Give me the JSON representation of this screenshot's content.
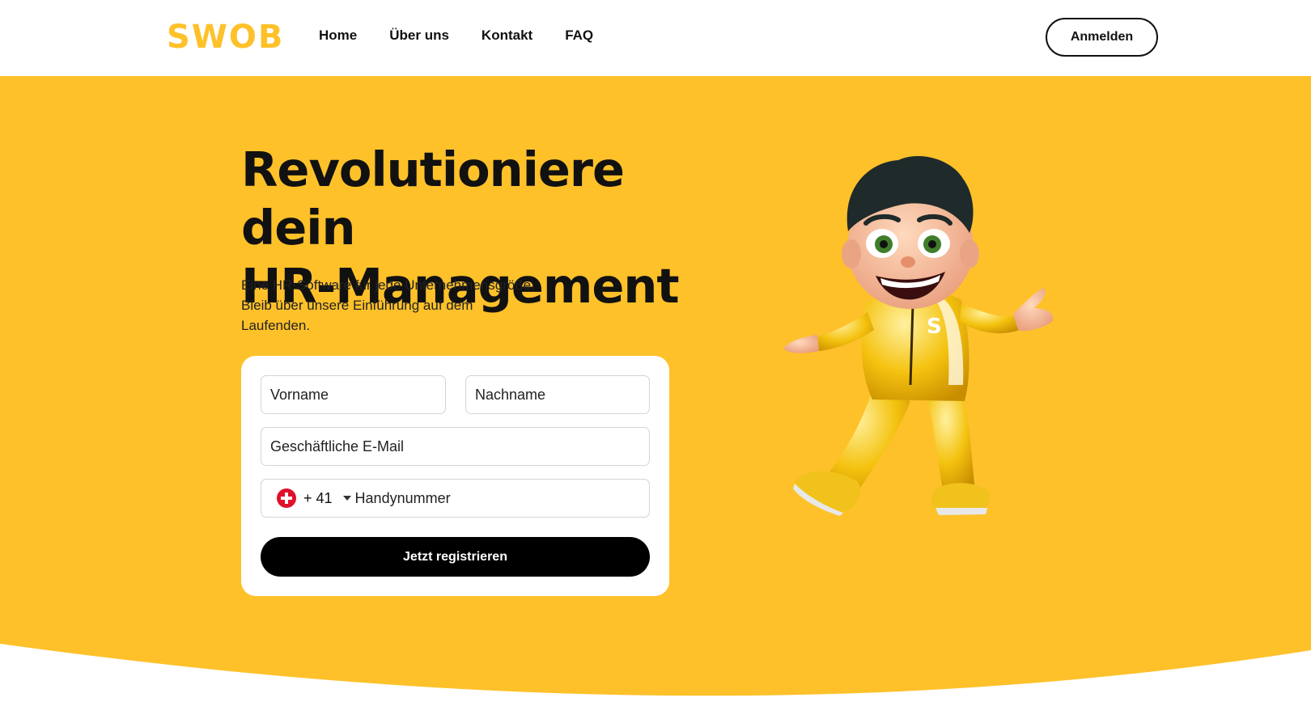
{
  "nav": {
    "logo": "SWOB",
    "links": [
      "Home",
      "Über uns",
      "Kontakt",
      "FAQ"
    ],
    "login_label": "Anmelden"
  },
  "hero": {
    "headline_line1": "Revolutioniere dein",
    "headline_line2": "HR-Management",
    "subtitle_line1": "Eine HR-Software für jede Unternehmensgröße.",
    "subtitle_line2": "Bleib über unsere Einführung auf dem",
    "subtitle_line3": "Laufenden.",
    "mascot_letter": "S"
  },
  "form": {
    "first_name_placeholder": "Vorname",
    "last_name_placeholder": "Nachname",
    "email_placeholder": "Geschäftliche E-Mail",
    "phone": {
      "country_flag": "swiss-flag-icon",
      "dial_code": "+ 41",
      "placeholder": "Handynummer"
    },
    "submit_label": "Jetzt registrieren"
  },
  "colors": {
    "brand_yellow": "#fec12a",
    "text_dark": "#111111",
    "button_black": "#000000",
    "flag_red": "#e0102b"
  }
}
